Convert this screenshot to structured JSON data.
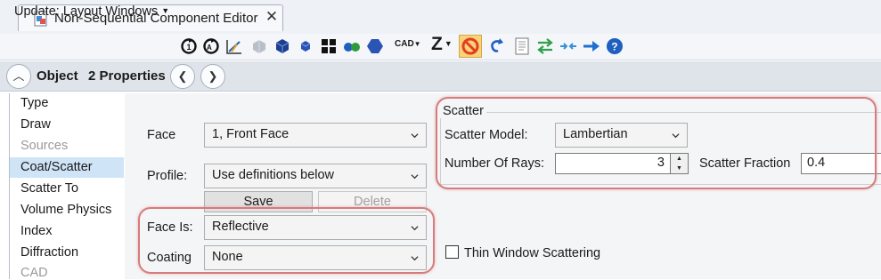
{
  "tab": {
    "title": "Non-Sequential Component Editor",
    "close_glyph": "✕",
    "icon": "document-icon"
  },
  "toolbar": {
    "update_label": "Update: Layout Windows",
    "cad_label": "CAD",
    "z_label": "Z",
    "icons": [
      "refresh-all-icon",
      "cad-refresh-icon",
      "ray-trace-icon",
      "ghost-object-icon",
      "solid-object-icon",
      "object-icon",
      "grid-icon",
      "pair-icon",
      "hexagon-icon",
      "cad-dropdown",
      "z-dropdown",
      "no-draw-icon",
      "undo-curve-icon",
      "page-icon",
      "swap-arrows-icon",
      "merge-arrows-icon",
      "right-arrow-icon",
      "help-icon"
    ]
  },
  "header": {
    "object_label": "Object",
    "properties_label": "2 Properties"
  },
  "nav": {
    "items": [
      {
        "label": "Type",
        "disabled": false
      },
      {
        "label": "Draw",
        "disabled": false
      },
      {
        "label": "Sources",
        "disabled": true
      },
      {
        "label": "Coat/Scatter",
        "disabled": false,
        "selected": true
      },
      {
        "label": "Scatter To",
        "disabled": false
      },
      {
        "label": "Volume Physics",
        "disabled": false
      },
      {
        "label": "Index",
        "disabled": false
      },
      {
        "label": "Diffraction",
        "disabled": false
      },
      {
        "label": "CAD",
        "disabled": true
      }
    ]
  },
  "coat": {
    "face_label": "Face",
    "face_value": "1, Front Face",
    "profile_label": "Profile:",
    "profile_value": "Use definitions below",
    "save_label": "Save",
    "delete_label": "Delete",
    "face_is_label": "Face Is:",
    "face_is_value": "Reflective",
    "coating_label": "Coating",
    "coating_value": "None"
  },
  "scatter": {
    "group_title": "Scatter",
    "model_label": "Scatter Model:",
    "model_value": "Lambertian",
    "rays_label": "Number Of Rays:",
    "rays_value": "3",
    "fraction_label": "Scatter Fraction",
    "fraction_value": "0.4",
    "thin_window_label": "Thin Window Scattering",
    "thin_window_checked": false
  },
  "colors": {
    "highlight": "#d77b7c",
    "selection": "#cfe4f7",
    "accent_blue": "#1f5fbf"
  }
}
